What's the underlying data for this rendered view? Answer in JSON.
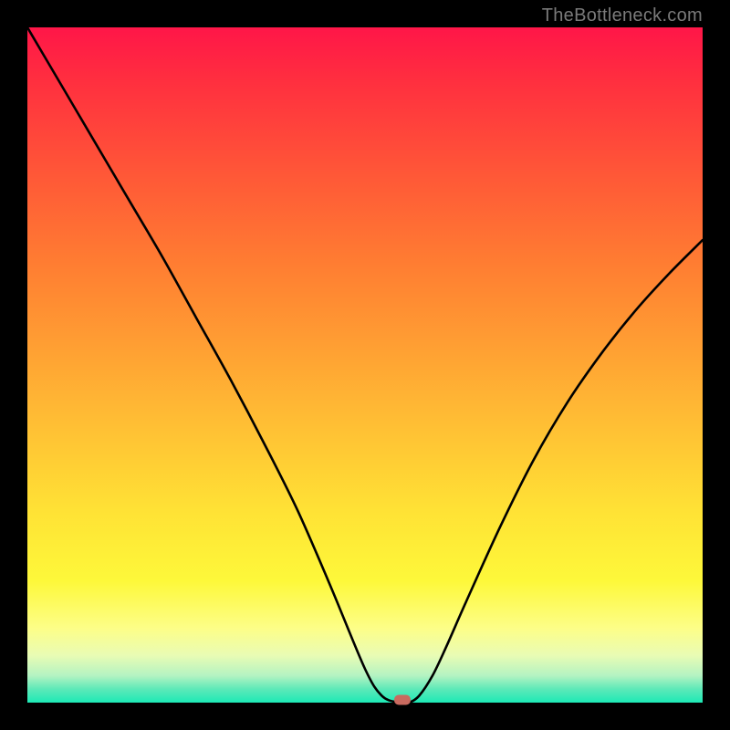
{
  "watermark": "TheBottleneck.com",
  "marker_color": "#c96a5f",
  "chart_data": {
    "type": "line",
    "title": "",
    "xlabel": "",
    "ylabel": "",
    "xlim": [
      0,
      100
    ],
    "ylim": [
      0,
      100
    ],
    "series": [
      {
        "name": "curve",
        "x": [
          0,
          5,
          10,
          15,
          20,
          25,
          30,
          35,
          40,
          45,
          50,
          52.5,
          55,
          56.5,
          58,
          60,
          62,
          65,
          70,
          75,
          80,
          85,
          90,
          95,
          100
        ],
        "values": [
          100,
          91.5,
          83,
          74.5,
          66,
          57,
          48,
          38.5,
          28.5,
          17,
          5,
          1,
          0,
          0,
          1,
          4,
          8.2,
          15,
          26,
          36,
          44.5,
          51.7,
          58,
          63.5,
          68.5
        ]
      }
    ],
    "marker": {
      "x": 55.5,
      "y": 0
    },
    "gradient_stops": [
      {
        "pos": 0,
        "color": "#ff1648"
      },
      {
        "pos": 50,
        "color": "#ffc234"
      },
      {
        "pos": 85,
        "color": "#fdfe88"
      },
      {
        "pos": 100,
        "color": "#1de9b6"
      }
    ]
  }
}
